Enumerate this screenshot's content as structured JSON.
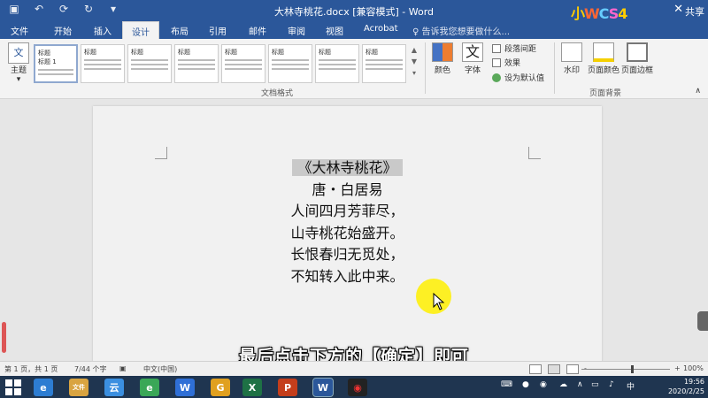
{
  "titlebar": {
    "title": "大林寺桃花.docx [兼容模式] - Word",
    "share": "共享",
    "brand_letters": [
      "小",
      "W",
      "C",
      "S",
      "4"
    ]
  },
  "tabs": [
    "文件",
    "开始",
    "插入",
    "设计",
    "布局",
    "引用",
    "邮件",
    "审阅",
    "视图",
    "Acrobat"
  ],
  "active_tab": "设计",
  "tell_me": "告诉我您想要做什么...",
  "ribbon": {
    "theme_label": "主题",
    "theme_icon_text": "文",
    "style_thumbs": [
      {
        "heading": "标题",
        "title": "标题 1"
      },
      {
        "heading": "标题",
        "title": ""
      },
      {
        "heading": "标题",
        "title": ""
      },
      {
        "heading": "标题",
        "title": ""
      },
      {
        "heading": "标题",
        "title": ""
      },
      {
        "heading": "标题",
        "title": ""
      },
      {
        "heading": "标题",
        "title": ""
      },
      {
        "heading": "标题",
        "title": ""
      }
    ],
    "group_doc_format": "文档格式",
    "colors_label": "颜色",
    "fonts_label": "字体",
    "fonts_icon_text": "文",
    "paragraph_spacing": "段落间距",
    "effects": "效果",
    "set_default": "设为默认值",
    "watermark": "水印",
    "page_color": "页面颜色",
    "page_borders": "页面边框",
    "group_page_bg": "页面背景"
  },
  "document": {
    "lines": [
      "《大林寺桃花》",
      "唐・白居易",
      "人间四月芳菲尽，",
      "山寺桃花始盛开。",
      "长恨春归无觅处，",
      "不知转入此中来。"
    ]
  },
  "caption": "最后点击下方的【确定】即可",
  "statusbar": {
    "page": "第 1 页，共 1 页",
    "words": "7/44 个字",
    "language": "中文(中国)",
    "zoom": "100%",
    "minus": "-",
    "plus": "+"
  },
  "taskbar": {
    "apps": [
      "e",
      "文件",
      "云",
      "e",
      "W",
      "G",
      "X",
      "P",
      "W",
      "◉"
    ],
    "tray_ime": "中",
    "clock_time": "19:56",
    "clock_date": "2020/2/25"
  },
  "colors": {
    "accent": "#2b579a",
    "highlight": "#fff000"
  }
}
